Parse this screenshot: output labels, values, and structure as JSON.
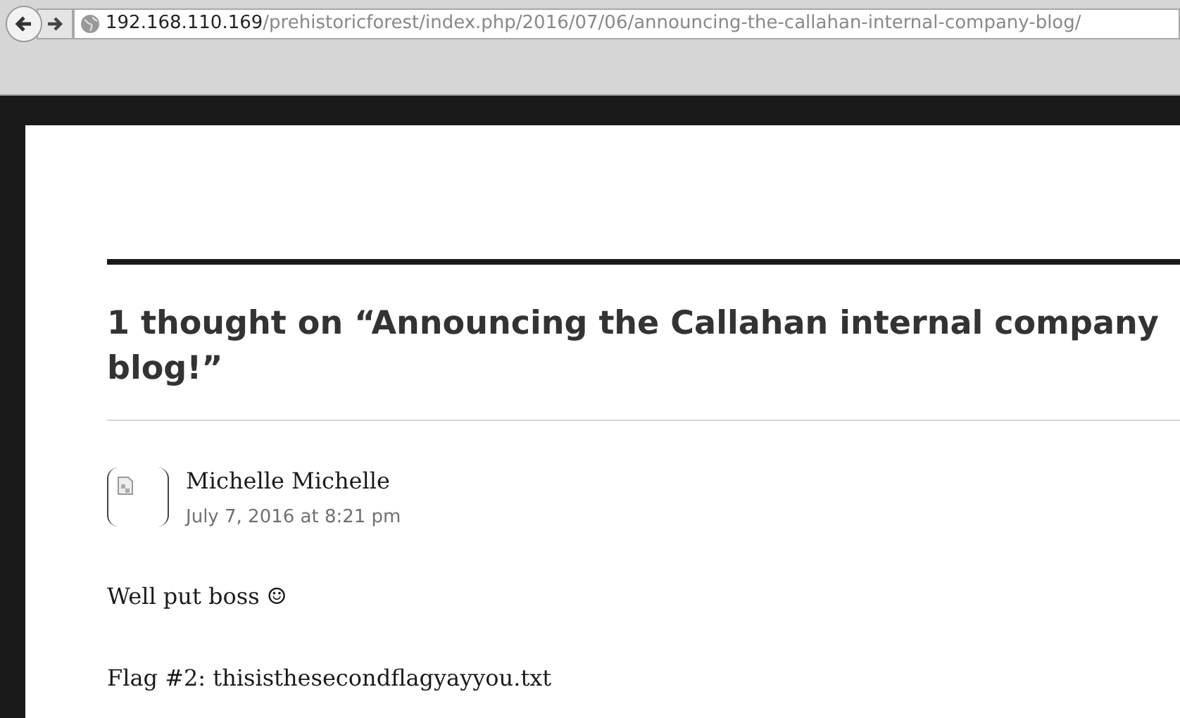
{
  "browser": {
    "url_host": "192.168.110.169",
    "url_path": "/prehistoricforest/index.php/2016/07/06/announcing-the-callahan-internal-company-blog/"
  },
  "comments_section": {
    "title": "1 thought on “Announcing the Callahan internal company blog!”",
    "comments": [
      {
        "author": "Michelle Michelle",
        "date": "July 7, 2016 at 8:21 pm",
        "paragraphs": [
          "Well put boss ☺",
          "Flag #2: thisisthesecondflagyayyou.txt"
        ]
      }
    ]
  }
}
